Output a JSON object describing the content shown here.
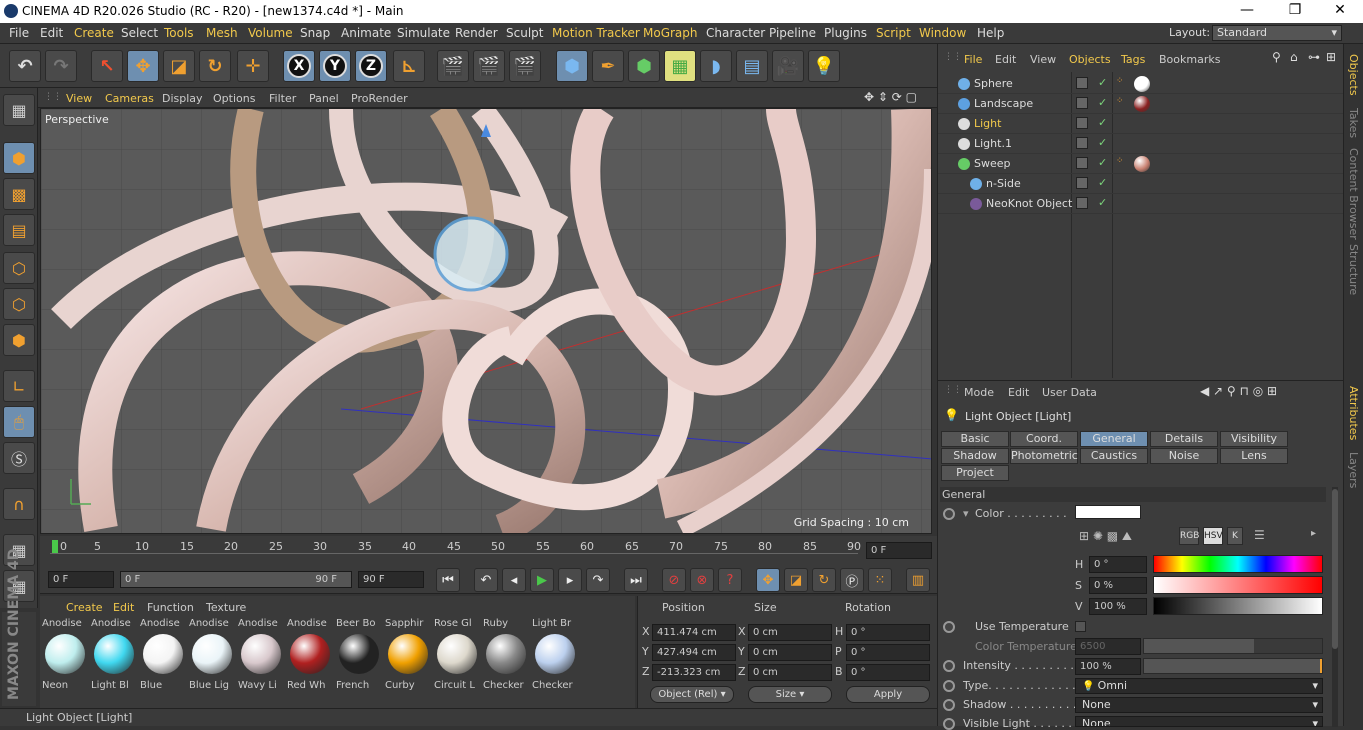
{
  "window": {
    "title": "CINEMA 4D R20.026 Studio (RC - R20) - [new1374.c4d *] - Main",
    "min": "—",
    "max": "❐",
    "close": "✕"
  },
  "menu": {
    "items": [
      "File",
      "Edit",
      "Create",
      "Select",
      "Tools",
      "Mesh",
      "Volume",
      "Snap",
      "Animate",
      "Simulate",
      "Render",
      "Sculpt",
      "Motion Tracker",
      "MoGraph",
      "Character",
      "Pipeline",
      "Plugins",
      "Script",
      "Window",
      "Help"
    ],
    "layout_label": "Layout:",
    "layout_value": "Standard"
  },
  "viewport": {
    "menu": [
      "View",
      "Cameras",
      "Display",
      "Options",
      "Filter",
      "Panel",
      "ProRender"
    ],
    "label": "Perspective",
    "grid_spacing": "Grid Spacing : 10 cm"
  },
  "timeline": {
    "ticks": [
      "0",
      "5",
      "10",
      "15",
      "20",
      "25",
      "30",
      "35",
      "40",
      "45",
      "50",
      "55",
      "60",
      "65",
      "70",
      "75",
      "80",
      "85",
      "90"
    ],
    "current_frame": "0 F"
  },
  "transport": {
    "start": "0 F",
    "range_start": "0 F",
    "range_end": "90 F",
    "end": "90 F"
  },
  "materials": {
    "menu": [
      "Create",
      "Edit",
      "Function",
      "Texture"
    ],
    "items": [
      {
        "top": "Anodise",
        "label": "Neon",
        "color": "#bfeeee"
      },
      {
        "top": "Anodise",
        "label": "Light Bl",
        "color": "#40d8f0"
      },
      {
        "top": "Anodise",
        "label": "Blue",
        "color": "#f4f4f4"
      },
      {
        "top": "Anodise",
        "label": "Blue Lig",
        "color": "#eaf4f8"
      },
      {
        "top": "Anodise",
        "label": "Wavy Li",
        "color": "#d8c8cc"
      },
      {
        "top": "Anodise",
        "label": "Red Wh",
        "color": "#b02020"
      },
      {
        "top": "Beer Bo",
        "label": "French",
        "color": "#222222"
      },
      {
        "top": "Sapphir",
        "label": "Curby",
        "color": "#f0a000"
      },
      {
        "top": "Rose Gl",
        "label": "Circuit L",
        "color": "#ddd8cc"
      },
      {
        "top": "Ruby",
        "label": "Checker",
        "color": "#888888"
      },
      {
        "top": "Light Br",
        "label": "Checker",
        "color": "#bcd0ee"
      }
    ]
  },
  "coords": {
    "headers": [
      "Position",
      "Size",
      "Rotation"
    ],
    "pos": [
      "411.474 cm",
      "427.494 cm",
      "-213.323 cm"
    ],
    "size": [
      "0 cm",
      "0 cm",
      "0 cm"
    ],
    "rot": [
      "0 °",
      "0 °",
      "0 °"
    ],
    "pos_labels": [
      "X",
      "Y",
      "Z"
    ],
    "size_labels": [
      "X",
      "Y",
      "Z"
    ],
    "rot_labels": [
      "H",
      "P",
      "B"
    ],
    "mode": "Object (Rel)",
    "size_mode": "Size",
    "apply": "Apply"
  },
  "status": "Light Object [Light]",
  "objects": {
    "menu": [
      "File",
      "Edit",
      "View",
      "Objects",
      "Tags",
      "Bookmarks"
    ],
    "items": [
      {
        "name": "Sphere",
        "icon": "#6fb0e8",
        "tag": "#ffffff"
      },
      {
        "name": "Landscape",
        "icon": "#5da0e0",
        "tag": "#8a2020"
      },
      {
        "name": "Light",
        "icon": "#dddddd",
        "tag": ""
      },
      {
        "name": "Light.1",
        "icon": "#dddddd",
        "tag": ""
      },
      {
        "name": "Sweep",
        "icon": "#66cc66",
        "tag": "#c88070"
      },
      {
        "name": "n-Side",
        "icon": "#6fb0e8",
        "tag": ""
      },
      {
        "name": "NeoKnot Object",
        "icon": "#7a5a9a",
        "tag": ""
      }
    ]
  },
  "attributes": {
    "menu": [
      "Mode",
      "Edit",
      "User Data"
    ],
    "title": "Light Object [Light]",
    "tabs": [
      "Basic",
      "Coord.",
      "General",
      "Details",
      "Visibility",
      "Shadow",
      "Photometric",
      "Caustics",
      "Noise",
      "Lens",
      "Project"
    ],
    "section": "General",
    "color_label": "Color . . . . . . . . .",
    "h_label": "H",
    "h_value": "0 °",
    "s_label": "S",
    "s_value": "0 %",
    "v_label": "V",
    "v_value": "100 %",
    "use_temp": "Use Temperature",
    "color_temp": "Color Temperature",
    "color_temp_value": "6500",
    "intensity_label": "Intensity . . . . . . . . .",
    "intensity_value": "100 %",
    "type_label": "Type. . . . . . . . . . . . .",
    "type_value": "Omni",
    "shadow_label": "Shadow . . . . . . . . . .",
    "shadow_value": "None",
    "visible_label": "Visible Light . . . . . .",
    "visible_value": "None"
  },
  "sidetabs": [
    "Objects",
    "Takes",
    "Content Browser",
    "Structure",
    "Attributes",
    "Layers"
  ]
}
